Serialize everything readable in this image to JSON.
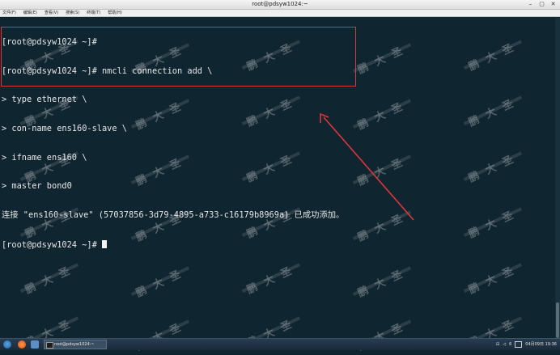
{
  "window": {
    "title": "root@pdsyw1024:~",
    "buttons": [
      "–",
      "▢",
      "✕"
    ]
  },
  "menubar": {
    "items": [
      "文件(F)",
      "编辑(E)",
      "查看(V)",
      "搜索(S)",
      "终端(T)",
      "帮助(H)"
    ]
  },
  "terminal": {
    "lines": [
      "[root@pdsyw1024 ~]#",
      "[root@pdsyw1024 ~]# nmcli connection add \\",
      "> type ethernet \\",
      "> con-name ens160-slave \\",
      "> ifname ens160 \\",
      "> master bond0",
      "连接 \"ens160-slave\" (57037856-3d79-4895-a733-c16179b8969a) 已成功添加。",
      "[root@pdsyw1024 ~]# "
    ]
  },
  "watermark": {
    "text": "鹏大圣"
  },
  "taskbar": {
    "task_label": "root@pdsyw1024:~",
    "clock": "04月09日 19:36",
    "tray_number": "6"
  },
  "colors": {
    "terminal_bg": "#0f2530",
    "terminal_fg": "#e6e6e6",
    "annotation": "#e0353d"
  }
}
